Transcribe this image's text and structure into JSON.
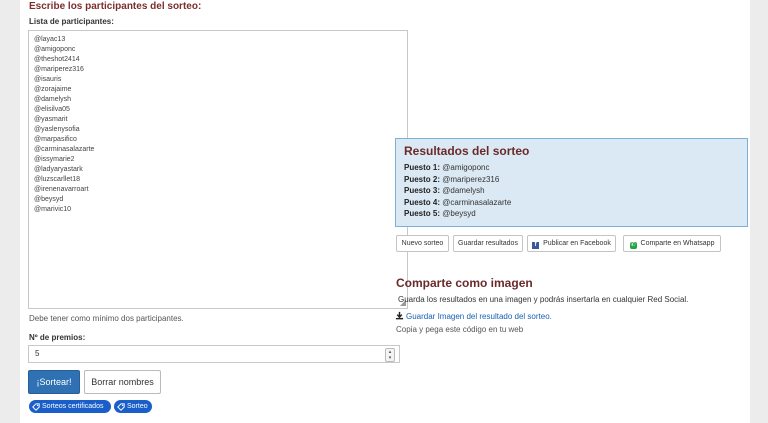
{
  "form": {
    "section_title": "Escribe los participantes del sorteo:",
    "list_label": "Lista de participantes:",
    "participants": [
      "@layac13",
      "@amigoponc",
      "@theshot2414",
      "@mariperez316",
      "@isauris",
      "@zorajaime",
      "@damelysh",
      "@elisilva05",
      "@yasmarit",
      "@yaslenysofia",
      "@marpasifico",
      "@carminasalazarte",
      "@issymarie2",
      "@ladyaryastark",
      "@luzscarllet18",
      "@irenenavarroart",
      "@beysyd",
      "@marivic10"
    ],
    "hint": "Debe tener como mínimo dos participantes.",
    "prizes_label": "Nº de premios:",
    "prizes_value": "5",
    "draw_button": "¡Sortear!",
    "clear_button": "Borrar nombres",
    "tags": [
      "Sorteos certificados",
      "Sorteo"
    ]
  },
  "results": {
    "title": "Resultados del sorteo",
    "rows": [
      {
        "label": "Puesto 1:",
        "value": "@amigoponc"
      },
      {
        "label": "Puesto 2:",
        "value": "@mariperez316"
      },
      {
        "label": "Puesto 3:",
        "value": "@damelysh"
      },
      {
        "label": "Puesto 4:",
        "value": "@carminasalazarte"
      },
      {
        "label": "Puesto 5:",
        "value": "@beysyd"
      }
    ],
    "actions": {
      "new": "Nuevo sorteo",
      "save": "Guardar resultados",
      "facebook": "Publicar en Facebook",
      "whatsapp": "Comparte en Whatsapp"
    }
  },
  "share": {
    "title": "Comparte como imagen",
    "description": "Guarda los resultados en una imagen y podrás insertarla en cualquier Red Social.",
    "link": "Guardar Imagen del resultado del sorteo.",
    "copy_hint": "Copia y pega este código en tu web"
  },
  "colors": {
    "accent": "#2f71b3",
    "heading": "#6b2a2a",
    "results_bg": "#dbe9f4",
    "tag_bg": "#1a5fc9"
  }
}
